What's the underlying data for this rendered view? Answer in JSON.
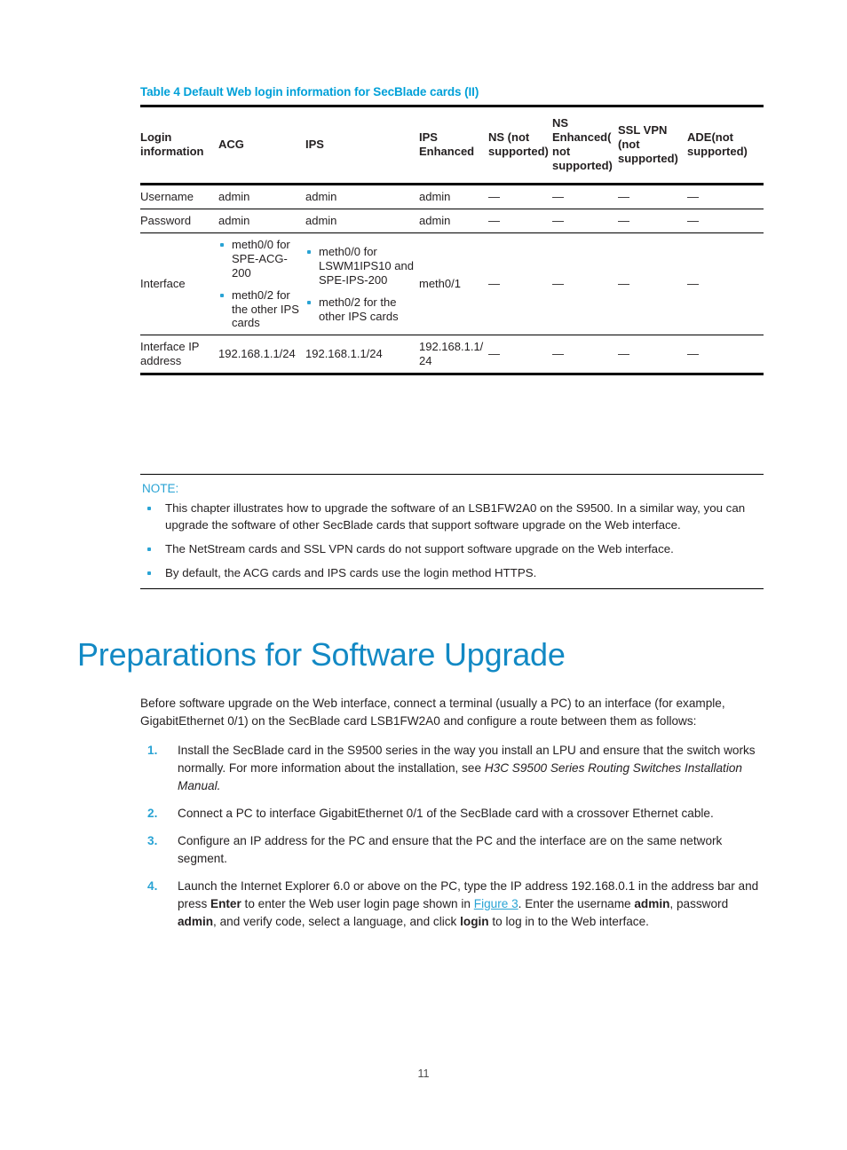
{
  "table": {
    "caption": "Table 4 Default Web login information for SecBlade cards (II)",
    "headers": [
      "Login information",
      "ACG",
      "IPS",
      "IPS Enhanced",
      "NS (not supported)",
      "NS Enhanced(not supported)",
      "SSL VPN (not supported)",
      "ADE(not supported)"
    ],
    "rows": [
      {
        "label": "Username",
        "acg": "admin",
        "ips": "admin",
        "ips_enhanced": "admin",
        "ns": "—",
        "ns_enhanced": "—",
        "ssl_vpn": "—",
        "ade": "—"
      },
      {
        "label": "Password",
        "acg": "admin",
        "ips": "admin",
        "ips_enhanced": "admin",
        "ns": "—",
        "ns_enhanced": "—",
        "ssl_vpn": "—",
        "ade": "—"
      },
      {
        "label": "Interface",
        "acg_bullets": [
          "meth0/0 for SPE-ACG-200",
          "meth0/2 for the other IPS cards"
        ],
        "ips_bullets": [
          "meth0/0 for LSWM1IPS10 and SPE-IPS-200",
          "meth0/2 for the other IPS cards"
        ],
        "ips_enhanced": "meth0/1",
        "ns": "—",
        "ns_enhanced": "—",
        "ssl_vpn": "—",
        "ade": "—"
      },
      {
        "label": "Interface IP address",
        "acg": "192.168.1.1/24",
        "ips": "192.168.1.1/24",
        "ips_enhanced": "192.168.1.1/24",
        "ns": "—",
        "ns_enhanced": "—",
        "ssl_vpn": "—",
        "ade": "—"
      }
    ]
  },
  "note": {
    "title": "NOTE:",
    "items": [
      "This chapter illustrates how to upgrade the software of an LSB1FW2A0 on the S9500. In a similar way, you can upgrade the software of other SecBlade cards that support software upgrade on the Web interface.",
      "The NetStream cards and SSL VPN cards do not support software upgrade on the Web interface.",
      "By default, the ACG cards and IPS cards use the login method HTTPS."
    ]
  },
  "heading": "Preparations for Software Upgrade",
  "intro": "Before software upgrade on the Web interface, connect a terminal (usually a PC) to an interface (for example, GigabitEthernet 0/1) on the SecBlade card LSB1FW2A0 and configure a route between them as follows:",
  "steps": {
    "step1": {
      "text_before": "Install the SecBlade card in the S9500 series in the way you install an LPU and ensure that the switch works normally. For more information about the installation, see ",
      "italic": "H3C S9500 Series Routing Switches  Installation Manual.",
      "text_after": ""
    },
    "step2": {
      "text": "Connect a PC to interface GigabitEthernet 0/1 of the SecBlade card with a crossover Ethernet cable."
    },
    "step3": {
      "text": "Configure an IP address for the PC and ensure that the PC and the interface are on the same network segment."
    },
    "step4": {
      "p1": "Launch the Internet Explorer 6.0 or above on the PC, type the IP address 192.168.0.1 in the address bar and press ",
      "bold1": "Enter",
      "p2": " to enter the Web user login page shown in ",
      "link": "Figure 3",
      "p3": ". Enter the username ",
      "bold2": "admin",
      "p4": ", password ",
      "bold3": "admin",
      "p5": ", and verify code, select a language, and click ",
      "bold4": "login",
      "p6": " to log in to the Web interface."
    }
  },
  "page_number": "11",
  "colors": {
    "accent_blue": "#29a3d4",
    "caption_blue": "#00a0d8",
    "heading_blue": "#1289c4",
    "text": "#231f20"
  }
}
